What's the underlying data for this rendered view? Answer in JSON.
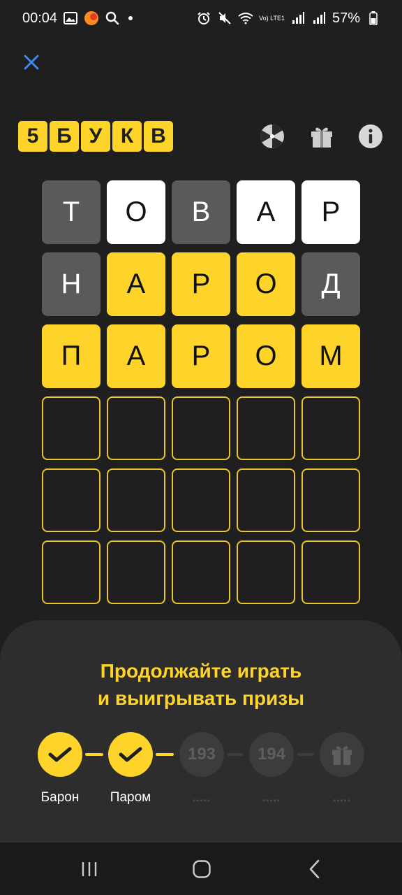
{
  "status_bar": {
    "time": "00:04",
    "battery": "57%",
    "network": "Vo) LTE1"
  },
  "header": {
    "logo_letters": [
      "5",
      "Б",
      "У",
      "К",
      "В"
    ],
    "icons": [
      "wheel-icon",
      "gift-icon",
      "info-icon"
    ]
  },
  "grid": {
    "rows": [
      [
        {
          "letter": "Т",
          "state": "gray"
        },
        {
          "letter": "О",
          "state": "white"
        },
        {
          "letter": "В",
          "state": "gray"
        },
        {
          "letter": "А",
          "state": "white"
        },
        {
          "letter": "Р",
          "state": "white"
        }
      ],
      [
        {
          "letter": "Н",
          "state": "gray"
        },
        {
          "letter": "А",
          "state": "yellow"
        },
        {
          "letter": "Р",
          "state": "yellow"
        },
        {
          "letter": "О",
          "state": "yellow"
        },
        {
          "letter": "Д",
          "state": "gray"
        }
      ],
      [
        {
          "letter": "П",
          "state": "yellow"
        },
        {
          "letter": "А",
          "state": "yellow"
        },
        {
          "letter": "Р",
          "state": "yellow"
        },
        {
          "letter": "О",
          "state": "yellow"
        },
        {
          "letter": "М",
          "state": "yellow"
        }
      ],
      [
        {
          "letter": "",
          "state": "empty"
        },
        {
          "letter": "",
          "state": "empty"
        },
        {
          "letter": "",
          "state": "empty"
        },
        {
          "letter": "",
          "state": "empty"
        },
        {
          "letter": "",
          "state": "empty"
        }
      ],
      [
        {
          "letter": "",
          "state": "empty"
        },
        {
          "letter": "",
          "state": "empty"
        },
        {
          "letter": "",
          "state": "empty"
        },
        {
          "letter": "",
          "state": "empty"
        },
        {
          "letter": "",
          "state": "empty"
        }
      ],
      [
        {
          "letter": "",
          "state": "empty"
        },
        {
          "letter": "",
          "state": "empty"
        },
        {
          "letter": "",
          "state": "empty"
        },
        {
          "letter": "",
          "state": "empty"
        },
        {
          "letter": "",
          "state": "empty"
        }
      ]
    ]
  },
  "panel": {
    "title_line1": "Продолжайте играть",
    "title_line2": "и выигрывать призы",
    "steps": [
      {
        "label": "Барон",
        "status": "done"
      },
      {
        "label": "Паром",
        "status": "done"
      },
      {
        "number": "193",
        "dots": "•••••",
        "status": "future"
      },
      {
        "number": "194",
        "dots": "•••••",
        "status": "future"
      },
      {
        "dots": "•••••",
        "status": "prize"
      }
    ]
  },
  "colors": {
    "background": "#1f1f1f",
    "accent_yellow": "#ffd42a",
    "gray_tile": "#5a5a5a",
    "panel": "#2d2d2d",
    "close_blue": "#3d8ef0"
  }
}
